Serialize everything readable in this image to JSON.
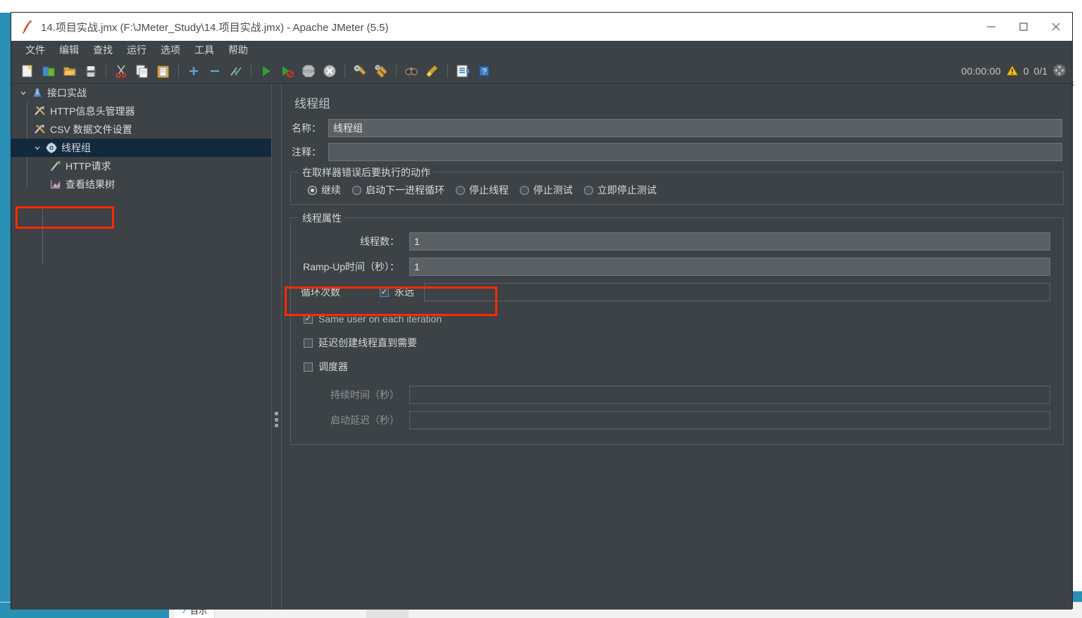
{
  "window": {
    "title": "14.项目实战.jmx (F:\\JMeter_Study\\14.项目实战.jmx) - Apache JMeter (5.5)",
    "app_icon": "jmeter-feather-icon",
    "minimize": "minimize-button",
    "maximize": "maximize-button",
    "close": "close-button"
  },
  "menubar": {
    "items": [
      {
        "label": "文件"
      },
      {
        "label": "编辑"
      },
      {
        "label": "查找"
      },
      {
        "label": "运行"
      },
      {
        "label": "选项"
      },
      {
        "label": "工具"
      },
      {
        "label": "帮助"
      }
    ]
  },
  "toolbar": {
    "buttons": [
      {
        "name": "new-icon"
      },
      {
        "name": "templates-icon"
      },
      {
        "name": "open-icon"
      },
      {
        "name": "save-icon"
      },
      {
        "name": "cut-icon"
      },
      {
        "name": "copy-icon"
      },
      {
        "name": "paste-icon"
      },
      {
        "name": "expand-all-icon"
      },
      {
        "name": "collapse-all-icon"
      },
      {
        "name": "toggle-icon"
      },
      {
        "name": "start-icon"
      },
      {
        "name": "start-no-pauses-icon"
      },
      {
        "name": "stop-icon"
      },
      {
        "name": "shutdown-icon"
      },
      {
        "name": "clear-icon"
      },
      {
        "name": "clear-all-icon"
      },
      {
        "name": "search-icon"
      },
      {
        "name": "reset-search-icon"
      },
      {
        "name": "function-helper-icon"
      },
      {
        "name": "help-icon"
      }
    ],
    "status": {
      "elapsed_time": "00:00:00",
      "warning_icon": "warning-triangle-icon",
      "warning_count": "0",
      "thread_counter": "0/1",
      "activity_icon": "activity-indicator-icon"
    }
  },
  "tree": {
    "nodes": [
      {
        "label": "接口实战",
        "icon": "test-plan-icon",
        "arrow": "chevron-down-icon",
        "depth": 0,
        "selected": false
      },
      {
        "label": "HTTP信息头管理器",
        "icon": "config-element-icon",
        "arrow": "",
        "depth": 1,
        "selected": false
      },
      {
        "label": "CSV 数据文件设置",
        "icon": "config-element-icon",
        "arrow": "",
        "depth": 1,
        "selected": false
      },
      {
        "label": "线程组",
        "icon": "thread-group-icon",
        "arrow": "chevron-down-icon",
        "depth": 1,
        "selected": true
      },
      {
        "label": "HTTP请求",
        "icon": "http-sampler-icon",
        "arrow": "",
        "depth": 2,
        "selected": false
      },
      {
        "label": "查看结果树",
        "icon": "view-results-tree-icon",
        "arrow": "",
        "depth": 2,
        "selected": false
      }
    ]
  },
  "main": {
    "panel_title": "线程组",
    "name_label": "名称：",
    "name_value": "线程组",
    "comment_label": "注释：",
    "comment_value": "",
    "error_action": {
      "group_title": "在取样器错误后要执行的动作",
      "options": [
        {
          "label": "继续",
          "selected": true
        },
        {
          "label": "启动下一进程循环",
          "selected": false
        },
        {
          "label": "停止线程",
          "selected": false
        },
        {
          "label": "停止测试",
          "selected": false
        },
        {
          "label": "立即停止测试",
          "selected": false
        }
      ]
    },
    "thread_properties": {
      "group_title": "线程属性",
      "threads_label": "线程数：",
      "threads_value": "1",
      "rampup_label": "Ramp-Up时间（秒）：",
      "rampup_value": "1",
      "loops_label": "循环次数",
      "loops_forever_label": "永远",
      "loops_forever_checked": true,
      "loops_value": "",
      "same_user_label": "Same user on each iteration",
      "same_user_checked": true,
      "delayed_start_label": "延迟创建线程直到需要",
      "delayed_start_checked": false,
      "scheduler_label": "调度器",
      "scheduler_checked": false,
      "duration_label": "持续时间（秒）",
      "duration_value": "",
      "startup_delay_label": "启动延迟（秒）",
      "startup_delay_value": ""
    }
  },
  "annotations": {
    "tree_highlight": "线程组",
    "loops_highlight": "循环次数 永远"
  },
  "taskbar": {
    "item_label": "目示",
    "note_icon": "note-icon"
  },
  "colors": {
    "panel_bg": "#3c4246",
    "selection": "#13293d",
    "annotation": "#ff2a00",
    "field_bg": "#5a6064",
    "text": "#d3d7d9"
  }
}
